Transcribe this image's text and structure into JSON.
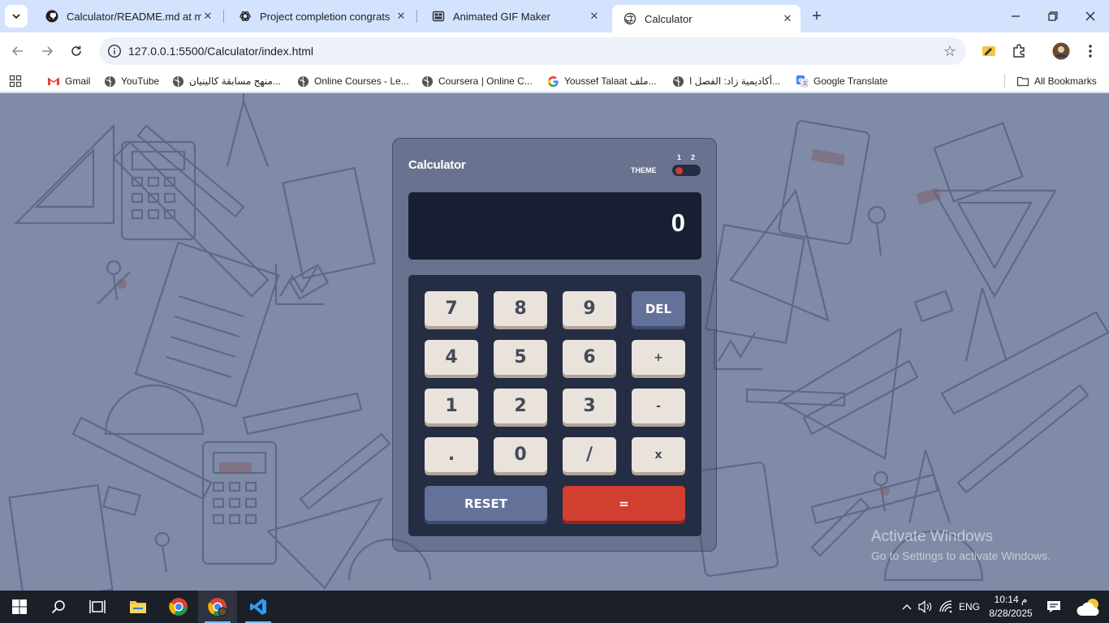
{
  "browser": {
    "tabs": [
      {
        "title": "Calculator/README.md at main",
        "icon": "github-icon",
        "active": false
      },
      {
        "title": "Project completion congrats",
        "icon": "chatgpt-icon",
        "active": false
      },
      {
        "title": "Animated GIF Maker",
        "icon": "gif-maker-icon",
        "active": false
      },
      {
        "title": "Calculator",
        "icon": "globe-icon",
        "active": true
      }
    ],
    "url": "127.0.0.1:5500/Calculator/index.html",
    "bookmarks": [
      {
        "label": "Gmail",
        "icon": "gmail-icon"
      },
      {
        "label": "YouTube",
        "icon": "globe-icon"
      },
      {
        "label": "منهج مسابقة كالينيان...",
        "icon": "globe-icon"
      },
      {
        "label": "Online Courses - Le...",
        "icon": "globe-icon"
      },
      {
        "label": "Coursera | Online C...",
        "icon": "globe-icon"
      },
      {
        "label": "Youssef Talaat ملف...",
        "icon": "google-icon"
      },
      {
        "label": "أكاديمية زاد: الفصل ا...",
        "icon": "globe-icon"
      },
      {
        "label": "Google Translate",
        "icon": "google-translate-icon"
      }
    ],
    "all_bookmarks": "All Bookmarks"
  },
  "calculator": {
    "title": "Calculator",
    "theme_label": "THEME",
    "theme_numbers": [
      "1",
      "2"
    ],
    "active_theme": 1,
    "display": "0",
    "keys": {
      "k7": "7",
      "k8": "8",
      "k9": "9",
      "del": "DEL",
      "k4": "4",
      "k5": "5",
      "k6": "6",
      "plus": "+",
      "k1": "1",
      "k2": "2",
      "k3": "3",
      "minus": "-",
      "dot": ".",
      "k0": "0",
      "divide": "/",
      "multiply": "x",
      "reset": "RESET",
      "equals": "="
    },
    "colors": {
      "screen": "#181f33",
      "keypad": "#242d44",
      "key": "#eae3dc",
      "key_blue": "#647198",
      "key_red": "#d03f2f"
    }
  },
  "watermark": {
    "line1": "Activate Windows",
    "line2": "Go to Settings to activate Windows."
  },
  "taskbar": {
    "language": "ENG",
    "time": "10:14 م",
    "date": "8/28/2025"
  }
}
